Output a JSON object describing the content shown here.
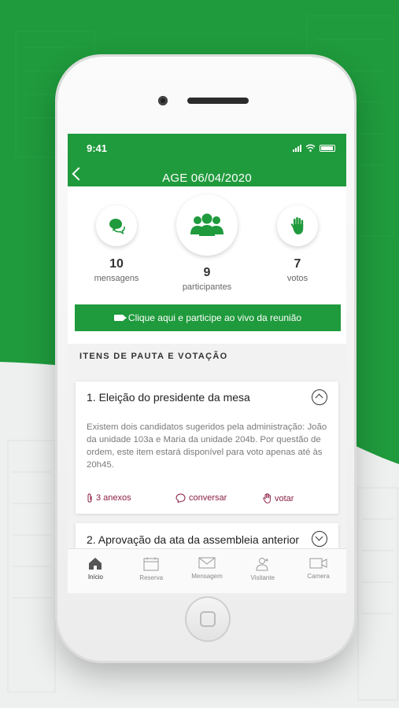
{
  "status_bar": {
    "time": "9:41"
  },
  "header": {
    "title": "AGE 06/04/2020"
  },
  "stats": [
    {
      "id": "mensagens",
      "value": "10",
      "label": "mensagens",
      "icon": "chat-icon"
    },
    {
      "id": "participantes",
      "value": "9",
      "label": "participantes",
      "icon": "people-icon"
    },
    {
      "id": "votos",
      "value": "7",
      "label": "votos",
      "icon": "hand-icon"
    }
  ],
  "live_button": {
    "label": "Clique aqui e participe ao vivo da reunião",
    "icon": "video-icon"
  },
  "section": {
    "title": "ITENS DE PAUTA E VOTAÇÃO"
  },
  "items": [
    {
      "title": "1. Eleição do presidente da mesa",
      "body": "Existem dois candidatos sugeridos pela administração: João da unidade 103a e Maria da unidade 204b. Por questão de ordem, este item estará disponível para voto apenas até às 20h45.",
      "actions": {
        "anexos": "3  anexos",
        "conversar": "conversar",
        "votar": "votar"
      }
    },
    {
      "title": "2. Aprovação da ata da assembleia anterior"
    }
  ],
  "tabs": [
    {
      "label": "Início",
      "icon": "home-icon",
      "active": true
    },
    {
      "label": "Reserva",
      "icon": "calendar-icon"
    },
    {
      "label": "Mensagem",
      "icon": "envelope-icon"
    },
    {
      "label": "Visitante",
      "icon": "visitor-icon"
    },
    {
      "label": "Camera",
      "icon": "camera-icon"
    }
  ],
  "colors": {
    "brand_green": "#1f9a3c",
    "action_color": "#8b1e45"
  }
}
